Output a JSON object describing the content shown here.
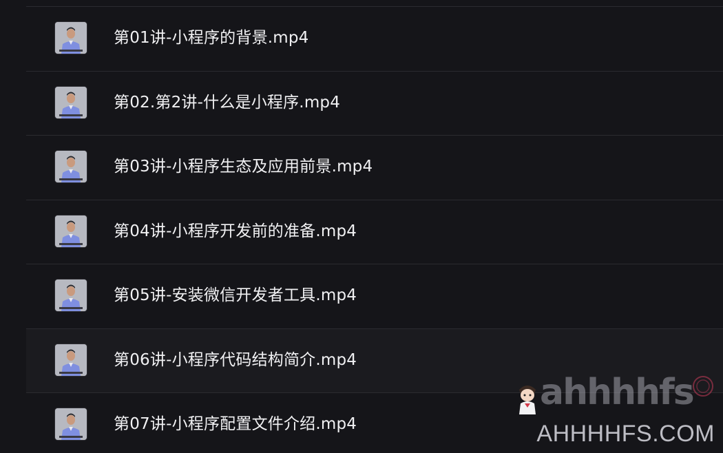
{
  "files": [
    {
      "name": "第01讲-小程序的背景.mp4"
    },
    {
      "name": "第02.第2讲-什么是小程序.mp4"
    },
    {
      "name": "第03讲-小程序生态及应用前景.mp4"
    },
    {
      "name": "第04讲-小程序开发前的准备.mp4"
    },
    {
      "name": "第05讲-安装微信开发者工具.mp4"
    },
    {
      "name": "第06讲-小程序代码结构简介.mp4"
    },
    {
      "name": "第07讲-小程序配置文件介绍.mp4"
    }
  ],
  "watermark": {
    "handle": "ahhhhfs",
    "domain": "AHHHHFS.COM"
  },
  "colors": {
    "background": "#151519",
    "divider": "#2b2b30",
    "hover_row": "#1b1b1f",
    "text": "#f1f1f3"
  }
}
